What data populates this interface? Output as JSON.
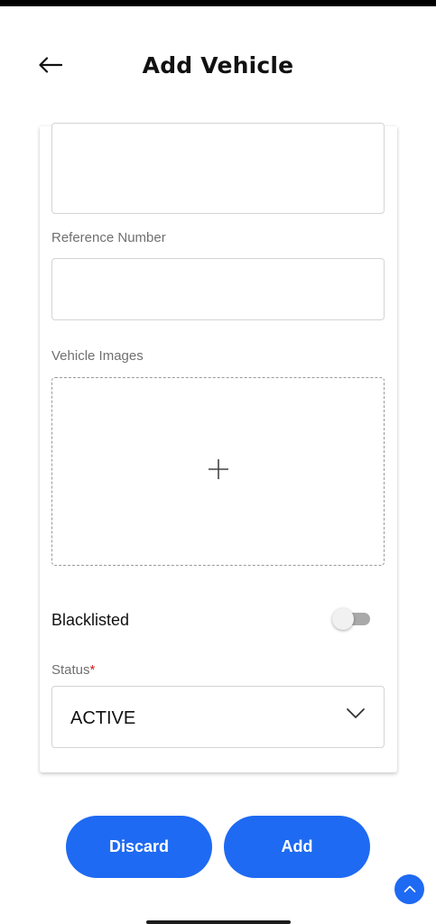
{
  "header": {
    "title": "Add Vehicle",
    "back_icon": "arrow-left-icon"
  },
  "form": {
    "reference_number": {
      "label": "Reference Number",
      "value": ""
    },
    "vehicle_images": {
      "label": "Vehicle Images",
      "add_icon": "plus-icon"
    },
    "blacklisted": {
      "label": "Blacklisted",
      "checked": false
    },
    "status": {
      "label": "Status",
      "required_mark": "*",
      "value": "ACTIVE",
      "chevron_icon": "chevron-down-icon"
    }
  },
  "actions": {
    "discard_label": "Discard",
    "add_label": "Add"
  },
  "scroll_top_icon": "chevron-up-icon",
  "colors": {
    "primary": "#1e6af2",
    "required": "#d21f1f"
  }
}
